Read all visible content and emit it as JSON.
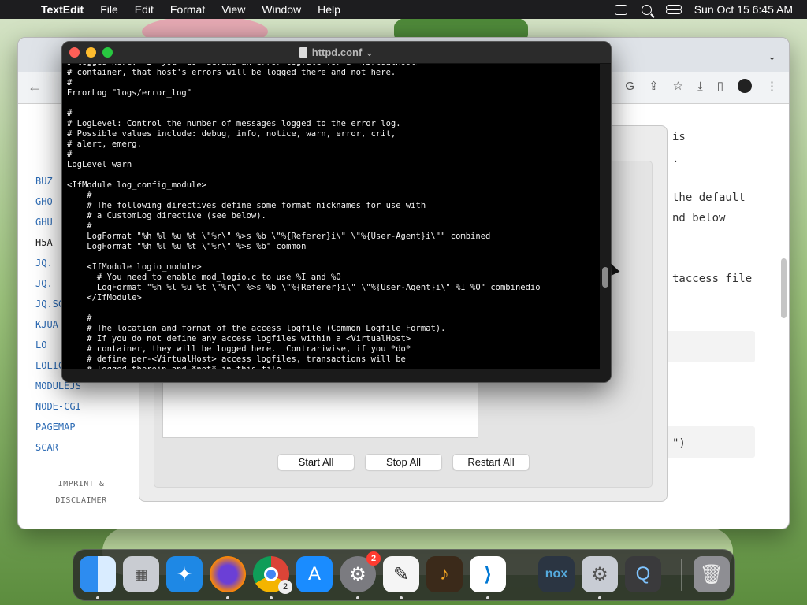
{
  "menubar": {
    "app_name": "TextEdit",
    "items": [
      "File",
      "Edit",
      "Format",
      "View",
      "Window",
      "Help"
    ],
    "clock": "Sun Oct 15  6:45 AM"
  },
  "browser": {
    "sidebar_links": [
      "BUZ",
      "GHO",
      "GHU",
      "H5A",
      "JQ.",
      "JQ.",
      "JQ.SC",
      "KJUA",
      "LO",
      "LOLIC",
      "MODULEJS",
      "NODE-CGI",
      "PAGEMAP",
      "SCAR"
    ],
    "imprint_line1": "IMPRINT &",
    "imprint_line2": "DISCLAIMER",
    "content_fragments": [
      "is",
      ".",
      "the default",
      "nd below",
      "taccess  file",
      "\")"
    ]
  },
  "dialog": {
    "start_all": "Start All",
    "stop_all": "Stop All",
    "restart_all": "Restart All"
  },
  "textedit": {
    "filename": "httpd.conf",
    "lines": [
      "# logged here.  If you *do* define an error logfile for a <VirtualHost>",
      "# container, that host's errors will be logged there and not here.",
      "#",
      "ErrorLog \"logs/error_log\"",
      "",
      "#",
      "# LogLevel: Control the number of messages logged to the error_log.",
      "# Possible values include: debug, info, notice, warn, error, crit,",
      "# alert, emerg.",
      "#",
      "LogLevel warn",
      "",
      "<IfModule log_config_module>",
      "    #",
      "    # The following directives define some format nicknames for use with",
      "    # a CustomLog directive (see below).",
      "    #",
      "    LogFormat \"%h %l %u %t \\\"%r\\\" %>s %b \\\"%{Referer}i\\\" \\\"%{User-Agent}i\\\"\" combined",
      "    LogFormat \"%h %l %u %t \\\"%r\\\" %>s %b\" common",
      "",
      "    <IfModule logio_module>",
      "      # You need to enable mod_logio.c to use %I and %O",
      "      LogFormat \"%h %l %u %t \\\"%r\\\" %>s %b \\\"%{Referer}i\\\" \\\"%{User-Agent}i\\\" %I %O\" combinedio",
      "    </IfModule>",
      "",
      "    #",
      "    # The location and format of the access logfile (Common Logfile Format).",
      "    # If you do not define any access logfiles within a <VirtualHost>",
      "    # container, they will be logged here.  Contrariwise, if you *do*",
      "    # define per-<VirtualHost> access logfiles, transactions will be",
      "    # logged therein and *not* in this file."
    ]
  },
  "dock": {
    "items": [
      "finder",
      "launchpad",
      "safari",
      "firefox",
      "chrome",
      "app-store",
      "system-preferences",
      "textedit",
      "garageband",
      "vscode",
      "nox",
      "settings",
      "quicktime",
      "trash"
    ],
    "system_preferences_badge": "2",
    "chrome_badge": "2"
  }
}
